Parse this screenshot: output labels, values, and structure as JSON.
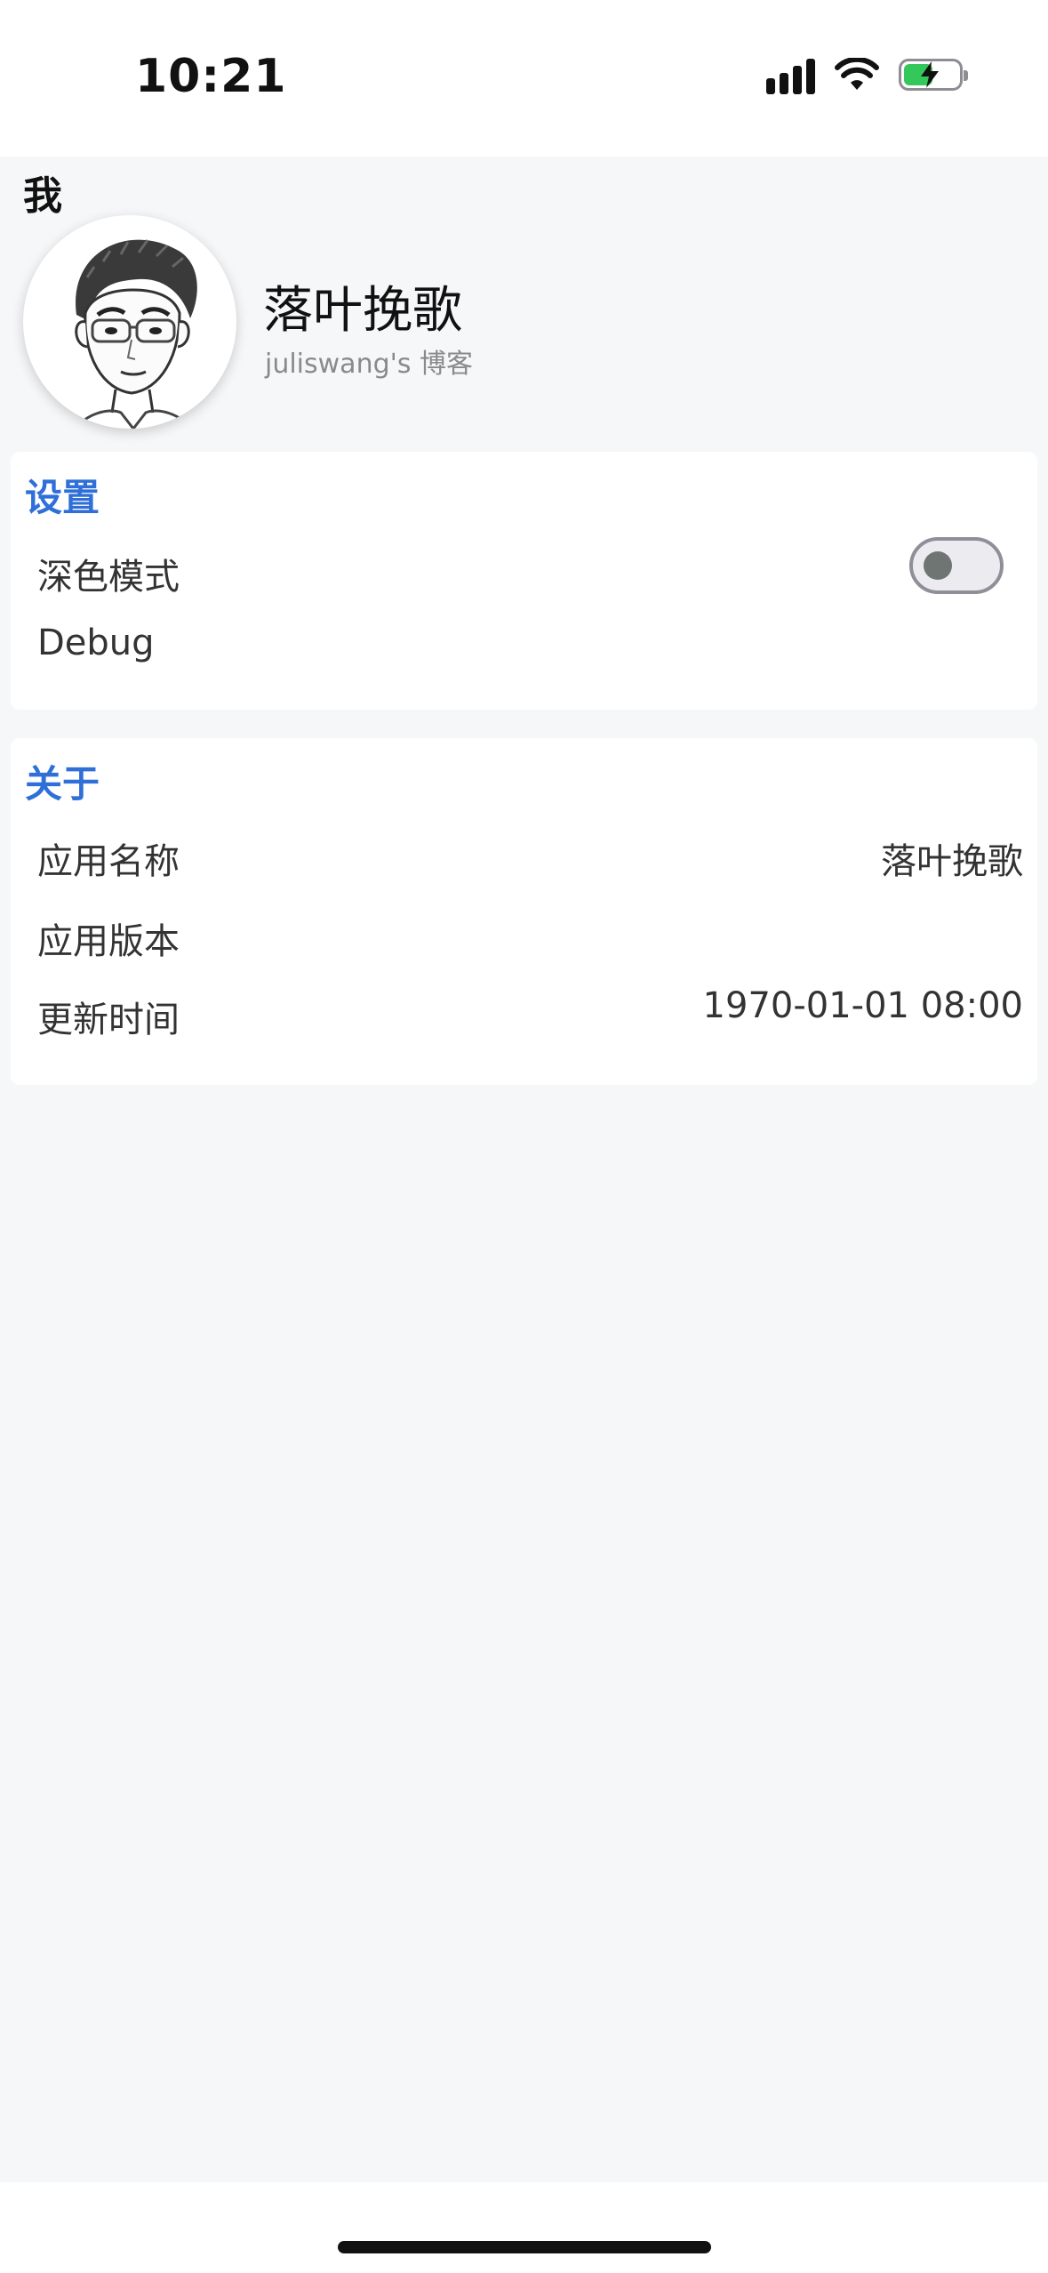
{
  "status_bar": {
    "time": "10:21",
    "battery_color": "#34c759"
  },
  "header": {
    "title": "我"
  },
  "profile": {
    "name": "落叶挽歌",
    "subtitle": "juliswang's 博客",
    "avatar_icon": "avatar-sketch-portrait"
  },
  "settings": {
    "title": "设置",
    "dark_mode_label": "深色模式",
    "dark_mode_on": false,
    "debug_label": "Debug"
  },
  "about": {
    "title": "关于",
    "rows": [
      {
        "label": "应用名称",
        "value": "落叶挽歌"
      },
      {
        "label": "应用版本",
        "value": ""
      },
      {
        "label": "更新时间",
        "value": "1970-01-01 08:00"
      }
    ]
  },
  "colors": {
    "accent": "#2f6fd8",
    "page_background": "#f6f7f9"
  }
}
